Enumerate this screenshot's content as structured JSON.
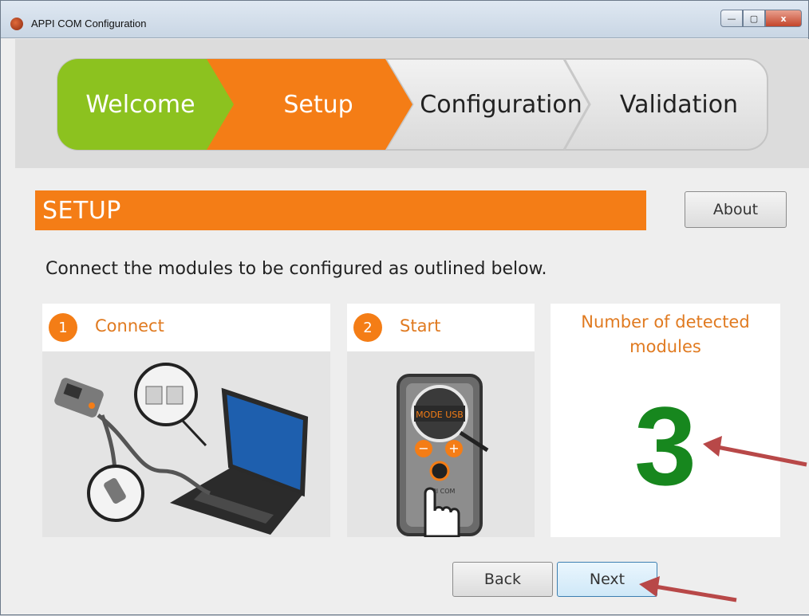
{
  "window": {
    "title": "APPI COM Configuration",
    "controls": {
      "minimize": "—",
      "maximize": "▢",
      "close": "x"
    }
  },
  "wizard": {
    "steps": [
      {
        "label": "Welcome",
        "state": "done",
        "color": "#8cc21f"
      },
      {
        "label": "Setup",
        "state": "active",
        "color": "#f47d16"
      },
      {
        "label": "Configuration",
        "state": "pending",
        "color": "#e6e6e6"
      },
      {
        "label": "Validation",
        "state": "pending",
        "color": "#e6e6e6"
      }
    ]
  },
  "section": {
    "title": "SETUP",
    "about_label": "About",
    "instruction": "Connect the modules to be configured as outlined below."
  },
  "panels": {
    "connect": {
      "number": "1",
      "title": "Connect"
    },
    "start": {
      "number": "2",
      "title": "Start",
      "screen_text": "MODE USB",
      "brand_text": "APPI COM"
    },
    "counter": {
      "label": "Number of detected modules",
      "value": "3"
    }
  },
  "footer": {
    "back_label": "Back",
    "next_label": "Next"
  },
  "colors": {
    "accent": "#f47d16",
    "success": "#17871e",
    "welcome": "#8cc21f",
    "annotation": "#b84848"
  }
}
